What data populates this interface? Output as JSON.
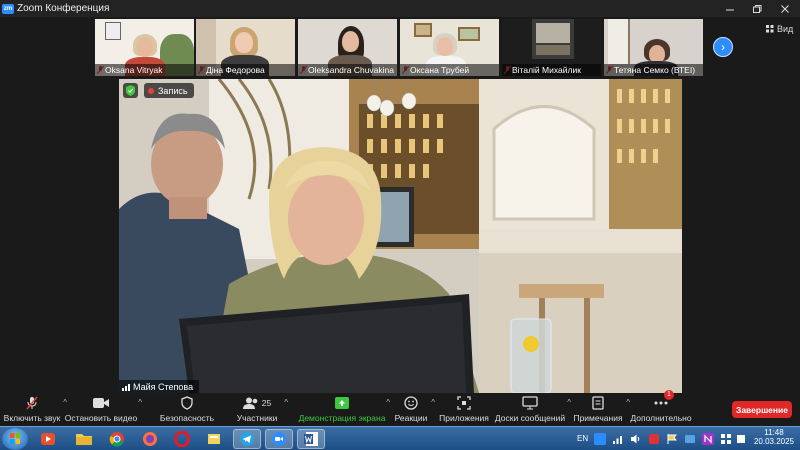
{
  "window": {
    "title": "Zoom Конференция",
    "logo_text": "zm"
  },
  "gallery": [
    {
      "name": "Oksana Vitryak",
      "muted": true
    },
    {
      "name": "Діна Федорова",
      "muted": true
    },
    {
      "name": "Oleksandra Chuvakina",
      "muted": true
    },
    {
      "name": "Оксана Трубей",
      "muted": true
    },
    {
      "name": "Віталій Михайлик",
      "muted": true
    },
    {
      "name": "Тетяна Семко (ВТЕІ)",
      "muted": true
    }
  ],
  "view_button": {
    "label": "Вид"
  },
  "main_video": {
    "speaker_name": "Майя Степова",
    "recording_label": "Запись"
  },
  "toolbar": {
    "mute": "Включить звук",
    "video": "Остановить видео",
    "security": "Безопасность",
    "participants": "Участники",
    "participants_count": "25",
    "share": "Демонстрация экрана",
    "reactions": "Реакции",
    "apps": "Приложения",
    "whiteboards": "Доски сообщений",
    "notes": "Примечания",
    "more": "Дополнительно",
    "more_badge": "1",
    "end": "Завершение"
  },
  "taskbar": {
    "language": "EN",
    "time": "11:48",
    "date": "20.03.2025"
  },
  "colors": {
    "accent": "#2d8cff",
    "end": "#e02828",
    "share": "#3ec83e"
  }
}
